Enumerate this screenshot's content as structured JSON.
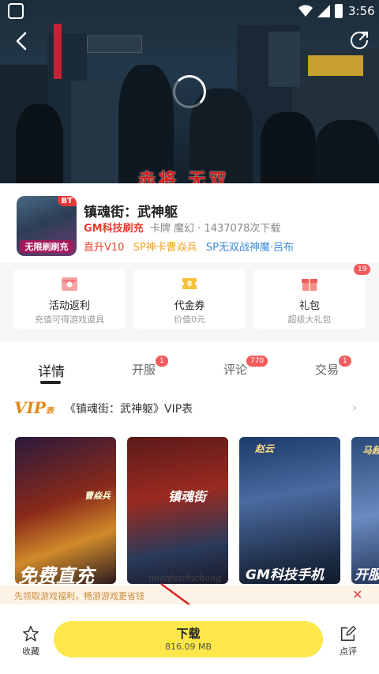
{
  "status_bar": {
    "time": "3:56"
  },
  "hero": {
    "overlay_text": "赤将 无双"
  },
  "app": {
    "title": "镇魂街：武神躯",
    "badge": "BT",
    "icon_tag": "无限刷刷充",
    "gm_label": "GM科技刷充",
    "genre": "卡牌 魔幻",
    "separator": "·",
    "downloads": "1437078次下载",
    "tags": [
      {
        "text": "直升V10",
        "color": "#e8452f"
      },
      {
        "text": "SP神卡曹焱兵",
        "color": "#f0a020"
      },
      {
        "text": "SP无双战神魔·吕布",
        "color": "#3c8ad8"
      }
    ]
  },
  "benefits": [
    {
      "title": "活动返利",
      "subtitle": "充值可得游戏道具",
      "icon": "rebate-envelope-icon"
    },
    {
      "title": "代金券",
      "subtitle": "价值0元",
      "icon": "voucher-icon"
    },
    {
      "title": "礼包",
      "subtitle": "超级大礼包",
      "icon": "gift-icon",
      "badge": "19"
    }
  ],
  "tabs": [
    {
      "label": "详情",
      "active": true
    },
    {
      "label": "开服",
      "badge": "1"
    },
    {
      "label": "评论",
      "badge": "770"
    },
    {
      "label": "交易",
      "badge": "1"
    }
  ],
  "vip": {
    "label": "VIP",
    "label_suffix": "表",
    "text": "《镇魂街：武神躯》VIP表"
  },
  "screenshots": [
    {
      "caption": "免费直充",
      "side_text": "曹焱兵"
    },
    {
      "caption": "镇魂街",
      "side_text": ""
    },
    {
      "caption": "GM科技手机",
      "side_text": "赵云"
    },
    {
      "caption": "开服",
      "side_text": "马超"
    }
  ],
  "watermark": "mianfeizhichong",
  "tip": {
    "text": "先领取游戏福利，畅游游戏更省钱",
    "close": "✕"
  },
  "bottom_bar": {
    "favorite_label": "收藏",
    "download_label": "下载",
    "download_size": "816.09 MB",
    "review_label": "点评"
  },
  "colors": {
    "accent_yellow": "#fde74a",
    "red": "#e7392e",
    "badge": "#f25c5c"
  }
}
